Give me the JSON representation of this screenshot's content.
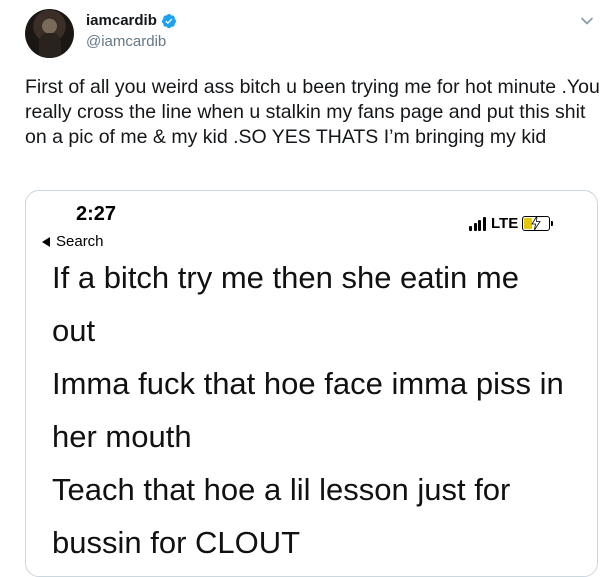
{
  "author": {
    "display_name": "iamcardib",
    "handle": "@iamcardib",
    "verified": true,
    "avatar_icon": "profile-photo"
  },
  "tweet": {
    "text": "First of all you weird ass bitch u been trying me for hot minute .You really cross the line when u stalkin my fans page and put this shit on a pic of me & my kid .SO YES THATS I’m bringing my kid"
  },
  "media": {
    "status_bar": {
      "time": "2:27",
      "back_label": "Search",
      "network": "LTE",
      "battery_level": 0.35,
      "battery_color": "#e7c800"
    },
    "paragraphs": [
      {
        "line1": "If a bitch try me then she eatin me",
        "line2": "out"
      },
      {
        "line1": "Imma fuck that hoe face imma piss in",
        "line2": "her mouth"
      },
      {
        "line1": "Teach that hoe a lil lesson just for",
        "line2": "bussin for CLOUT"
      }
    ]
  },
  "colors": {
    "verified_blue": "#1da1f2",
    "handle_gray": "#657786",
    "border": "#ccd6dd"
  }
}
